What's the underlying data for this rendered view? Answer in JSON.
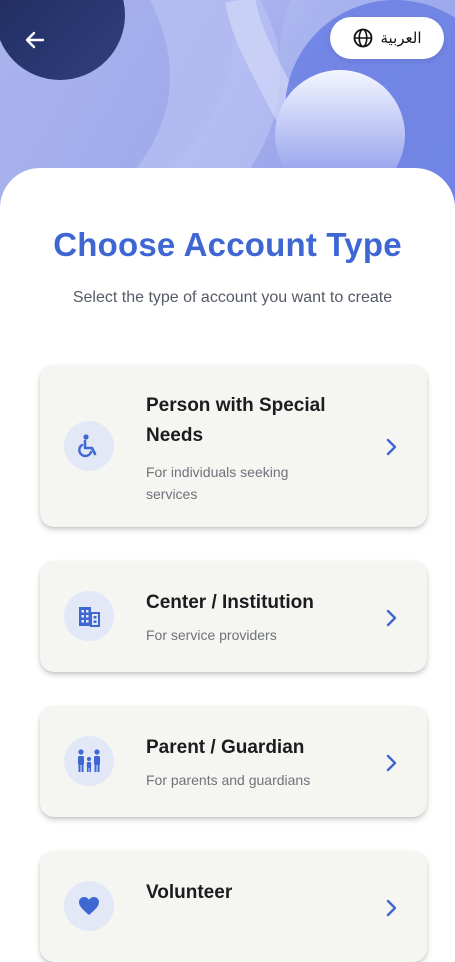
{
  "header": {
    "language_label": "العربية",
    "back_icon": "arrow-left-icon",
    "language_icon": "globe-icon"
  },
  "main": {
    "title": "Choose Account Type",
    "subtitle": "Select the type of account you want to create",
    "account_types": [
      {
        "title_line1": "Person with Special",
        "title_line2": "Needs",
        "desc_line1": "For individuals seeking",
        "desc_line2": "services",
        "icon": "wheelchair-icon"
      },
      {
        "title": "Center / Institution",
        "desc": "For service providers",
        "icon": "building-icon"
      },
      {
        "title": "Parent / Guardian",
        "desc": "For parents and guardians",
        "icon": "family-icon"
      },
      {
        "title": "Volunteer",
        "icon": "heart-icon"
      }
    ]
  },
  "colors": {
    "accent": "#3f67d4",
    "card_background": "#f5f5f2",
    "icon_background": "#e3e8f7"
  }
}
